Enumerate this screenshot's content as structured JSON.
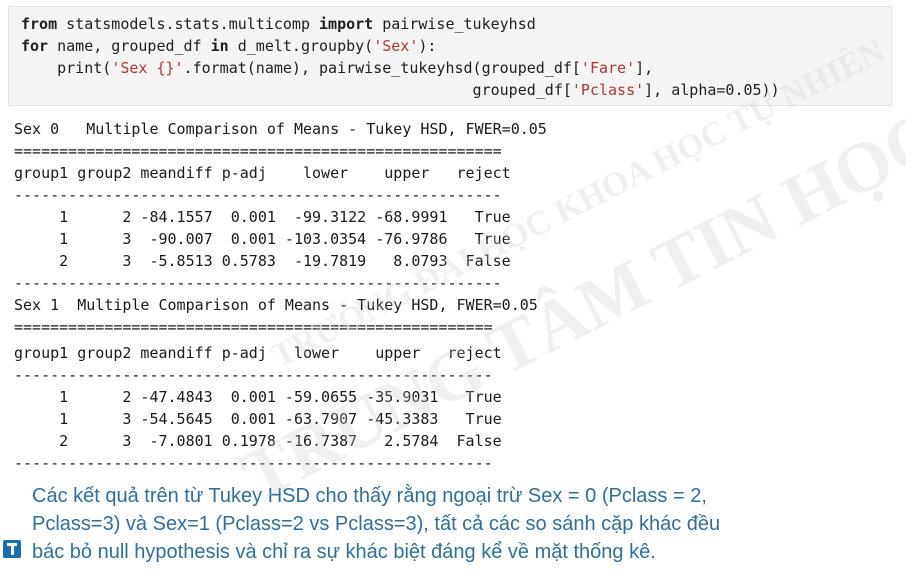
{
  "code": {
    "lines": [
      {
        "parts": [
          {
            "t": "from",
            "c": "kw"
          },
          {
            "t": " statsmodels.stats.multicomp ",
            "c": ""
          },
          {
            "t": "import",
            "c": "kw"
          },
          {
            "t": " pairwise_tukeyhsd",
            "c": ""
          }
        ]
      },
      {
        "parts": [
          {
            "t": "for",
            "c": "kw"
          },
          {
            "t": " name, grouped_df ",
            "c": ""
          },
          {
            "t": "in",
            "c": "kw"
          },
          {
            "t": " d_melt.groupby(",
            "c": ""
          },
          {
            "t": "'Sex'",
            "c": "str"
          },
          {
            "t": "):",
            "c": ""
          }
        ]
      },
      {
        "parts": [
          {
            "t": "    print(",
            "c": ""
          },
          {
            "t": "'Sex {}'",
            "c": "str"
          },
          {
            "t": ".format(name), pairwise_tukeyhsd(grouped_df[",
            "c": ""
          },
          {
            "t": "'Fare'",
            "c": "str"
          },
          {
            "t": "],",
            "c": ""
          }
        ]
      },
      {
        "parts": [
          {
            "t": "                                                  grouped_df[",
            "c": ""
          },
          {
            "t": "'Pclass'",
            "c": "str"
          },
          {
            "t": "], alpha=0.05))",
            "c": ""
          }
        ]
      }
    ]
  },
  "output": {
    "lines": [
      "Sex 0   Multiple Comparison of Means - Tukey HSD, FWER=0.05",
      "======================================================",
      "group1 group2 meandiff p-adj    lower    upper   reject",
      "------------------------------------------------------",
      "     1      2 -84.1557  0.001  -99.3122 -68.9991   True",
      "     1      3  -90.007  0.001 -103.0354 -76.9786   True",
      "     2      3  -5.8513 0.5783  -19.7819   8.0793  False",
      "------------------------------------------------------",
      "Sex 1  Multiple Comparison of Means - Tukey HSD, FWER=0.05",
      "=====================================================",
      "group1 group2 meandiff p-adj   lower    upper   reject",
      "-----------------------------------------------------",
      "     1      2 -47.4843  0.001 -59.0655 -35.9031   True",
      "     1      3 -54.5645  0.001 -63.7907 -45.3383   True",
      "     2      3  -7.0801 0.1978 -16.7387   2.5784  False",
      "-----------------------------------------------------"
    ]
  },
  "explanation": {
    "lines": [
      "Các kết quả trên từ Tukey HSD cho thấy rằng ngoại trừ Sex = 0 (Pclass = 2,",
      "Pclass=3) và Sex=1 (Pclass=2 vs Pclass=3), tất cả các so sánh cặp khác đều",
      "bác bỏ null hypothesis và chỉ ra sự khác biệt đáng kể về mặt thống kê."
    ]
  },
  "watermark": {
    "line1": "TRƯỜNG ĐẠI HỌC KHOA HỌC TỰ NHIÊN",
    "line2": "TRUNG TÂM TIN HỌC"
  },
  "colors": {
    "code_bg": "#f5f5f5",
    "string": "#b83232",
    "explanation_text": "#2f6f9e",
    "logo": "#1c6fb0"
  }
}
